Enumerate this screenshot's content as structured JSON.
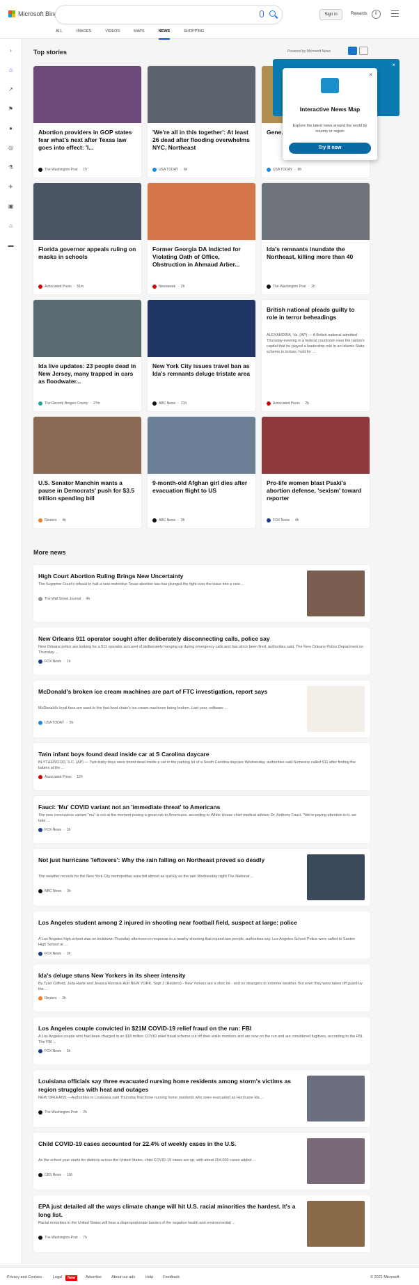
{
  "header": {
    "brand": "Microsoft Bing",
    "signin": "Sign in",
    "rewards": "Rewards",
    "rewards_count": "0",
    "nav": [
      "ALL",
      "IMAGES",
      "VIDEOS",
      "MAPS",
      "NEWS",
      "SHOPPING"
    ],
    "active_nav": "NEWS"
  },
  "top_stories": {
    "title": "Top stories",
    "powered_by": "Powered by Microsoft News",
    "cards": [
      {
        "title": "Abortion providers in GOP states fear what's next after Texas law goes into effect: 'I...",
        "source": "The Washington Post",
        "time": "1h",
        "img_color": "#6b4a7a",
        "dot": "#111"
      },
      {
        "title": "'We're all in this together': At least 26 dead after flooding overwhelms NYC, Northeast",
        "source": "USA TODAY",
        "time": "6h",
        "img_color": "#5d6470",
        "dot": "#1a8ce0"
      },
      {
        "title": "Gene... halt p... plant...",
        "source": "USA TODAY",
        "time": "8h",
        "img_color": "#b08e50",
        "dot": "#1a8ce0"
      },
      {
        "title": "Florida governor appeals ruling on masks in schools",
        "source": "Associated Press",
        "time": "51m",
        "img_color": "#4b5566",
        "dot": "#c00"
      },
      {
        "title": "Former Georgia DA Indicted for Violating Oath of Office, Obstruction in Ahmaud Arber...",
        "source": "Newsweek",
        "time": "2h",
        "img_color": "#d4754a",
        "dot": "#d00"
      },
      {
        "title": "Ida's remnants inundate the Northeast, killing more than 40",
        "source": "The Washington Post",
        "time": "2h",
        "img_color": "#6f747b",
        "dot": "#111"
      },
      {
        "title": "Ida live updates: 23 people dead in New Jersey, many trapped in cars as floodwater...",
        "source": "The Record, Bergen County",
        "time": "27m",
        "img_color": "#5a6a72",
        "dot": "#2a9"
      },
      {
        "title": "New York City issues travel ban as Ida's remnants deluge tristate area",
        "source": "ABC News",
        "time": "21h",
        "img_color": "#1f3566",
        "dot": "#111"
      },
      {
        "title": "British national pleads guilty to role in terror beheadings",
        "desc": "ALEXANDRIA, Va. (AP) — A British national admitted Thursday evening in a federal courtroom near the nation's capital that he played a leadership role in an Islamic State scheme to torture, hold for ...",
        "source": "Associated Press",
        "time": "2h",
        "img_color": "",
        "dot": "#c00"
      },
      {
        "title": "U.S. Senator Manchin wants a pause in Democrats' push for $3.5 trillion spending bill",
        "source": "Reuters",
        "time": "4h",
        "img_color": "#8a6a55",
        "dot": "#f08030"
      },
      {
        "title": "9-month-old Afghan girl dies after evacuation flight to US",
        "source": "ABC News",
        "time": "3h",
        "img_color": "#6b7f96",
        "dot": "#111"
      },
      {
        "title": "Pro-life women blast Psaki's abortion defense, 'sexism' toward reporter",
        "source": "FOX News",
        "time": "4h",
        "img_color": "#8e3a3a",
        "dot": "#1a3a8a"
      }
    ]
  },
  "popup": {
    "title": "Interactive News Map",
    "desc": "Explore the latest news around the world by country or region",
    "button": "Try it now"
  },
  "more_news": {
    "title": "More news",
    "items": [
      {
        "title": "High Court Abortion Ruling Brings New Uncertainty",
        "desc": "The Supreme Court's refusal to halt a new restrictive Texas abortion law has plunged the fight over the issue into a new ...",
        "source": "The Wall Street Journal",
        "time": "4h",
        "img_color": "#7a5e50",
        "dot": "#999"
      },
      {
        "title": "New Orleans 911 operator sought after deliberately disconnecting calls, police say",
        "desc": "New Orleans police are looking for a 911 operator accused of deliberately hanging up during emergency calls and has since been fired, authorities said.  The New Orleans Police Department on Thursday ...",
        "source": "FOX News",
        "time": "1h",
        "img_color": "",
        "dot": "#1a3a8a"
      },
      {
        "title": "McDonald's broken ice cream machines are part of FTC investigation, report says",
        "desc": "McDonald's loyal fans are used to the fast-food chain's ice cream machines being broken. Last year, software ...",
        "source": "USA TODAY",
        "time": "5h",
        "img_color": "#f3efe8",
        "dot": "#1a8ce0"
      },
      {
        "title": "Twin infant boys found dead inside car at S Carolina daycare",
        "desc": "BLYTHEWOOD, S.C. (AP) — Twin baby boys were found dead inside a car in the parking lot of a South Carolina daycare Wednesday, authorities said.Someone called 911 after finding the babies at the ...",
        "source": "Associated Press",
        "time": "12h",
        "img_color": "",
        "dot": "#c00"
      },
      {
        "title": "Fauci: 'Mu' COVID variant not an 'immediate threat' to Americans",
        "desc": "The new coronavirus variant \"mu\" is not at the moment posing a great risk to Americans, according to White House chief medical advisor Dr. Anthony Fauci. \"We're paying attention to it, we take ...",
        "source": "FOX News",
        "time": "3h",
        "img_color": "",
        "dot": "#1a3a8a"
      },
      {
        "title": "Not just hurricane 'leftovers': Why the rain falling on Northeast proved so deadly",
        "desc": "The weather records for the New York City metropolitan area fell almost as quickly as the rain Wednesday night The National ...",
        "source": "NBC News",
        "time": "3h",
        "img_color": "#3a4a5a",
        "dot": "#111"
      },
      {
        "title": "Los Angeles student among 2 injured in shooting near football field, suspect at large: police",
        "desc": "A Los Angeles high school was on lockdown Thursday afternoon in response to a nearby shooting that injured two people, authorities say.  Los Angeles School Police were called to Santee High School at ...",
        "source": "FOX News",
        "time": "3h",
        "img_color": "",
        "dot": "#1a3a8a"
      },
      {
        "title": "Ida's deluge stuns New Yorkers in its sheer intensity",
        "desc": "By Tyler Clifford, Julia Harte and Jessica Resnick-Ault NEW YORK, Sept 2 (Reuters) - New Yorkers are a stoic lot - and no strangers to extreme weather. But even they were taken off guard by the ...",
        "source": "Reuters",
        "time": "3h",
        "img_color": "",
        "dot": "#f08030"
      },
      {
        "title": "Los Angeles couple convicted in $21M COVID-19 relief fraud on the run: FBI",
        "desc": "A Los Angeles couple who had been charged in an $18 million COVID relief fraud scheme cut off their ankle monitors and are now on the run and are considered fugitives, according to the FBI.  The FBI ...",
        "source": "FOX News",
        "time": "5h",
        "img_color": "",
        "dot": "#1a3a8a"
      },
      {
        "title": "Louisiana officials say three evacuated nursing home residents among storm's victims as region struggles with heat and outages",
        "desc": "NEW ORLEANS —Authorities in Louisiana said Thursday that three nursing home residents who were evacuated as Hurricane Ida ...",
        "source": "The Washington Post",
        "time": "2h",
        "img_color": "#6b6f80",
        "dot": "#111"
      },
      {
        "title": "Child COVID-19 cases accounted for 22.4% of weekly cases in the U.S.",
        "desc": "As the school year starts for districts across the United States, child COVID-19 cases are up, with about 204,000 cases added ...",
        "source": "CBS News",
        "time": "10h",
        "img_color": "#7a6a78",
        "dot": "#111"
      },
      {
        "title": "EPA just detailed all the ways climate change will hit U.S. racial minorities the hardest. It's a long list.",
        "desc": "Racial minorities in the United States will bear a disproportionate burden of the negative health and environmental ...",
        "source": "The Washington Post",
        "time": "7h",
        "img_color": "#8a6a48",
        "dot": "#111"
      }
    ]
  },
  "footer": {
    "privacy": "Privacy and Cookies",
    "legal": "Legal",
    "new": "New",
    "advertise": "Advertise",
    "about": "About our ads",
    "help": "Help",
    "feedback": "Feedback",
    "copyright": "© 2021 Microsoft"
  }
}
